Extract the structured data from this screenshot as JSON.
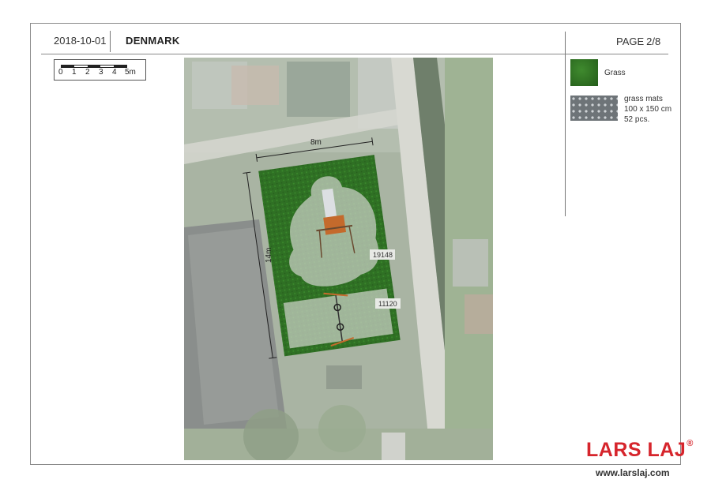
{
  "header": {
    "date": "2018-10-01",
    "country": "DENMARK",
    "page_label": "PAGE",
    "page_number": "2/8"
  },
  "scale": {
    "ticks": [
      "0",
      "1",
      "2",
      "3",
      "4",
      "5m"
    ]
  },
  "plan": {
    "width_label": "8m",
    "length_label": "14m",
    "item_top_code": "19148",
    "item_bottom_code": "11120"
  },
  "legend": {
    "grass_label": "Grass",
    "mats_line1": "grass mats",
    "mats_line2": "100 x 150 cm",
    "mats_line3": "52 pcs."
  },
  "brand": {
    "name": "LARS LAJ",
    "reg_mark": "®",
    "url": "www.larslaj.com",
    "color": "#d6252c"
  }
}
